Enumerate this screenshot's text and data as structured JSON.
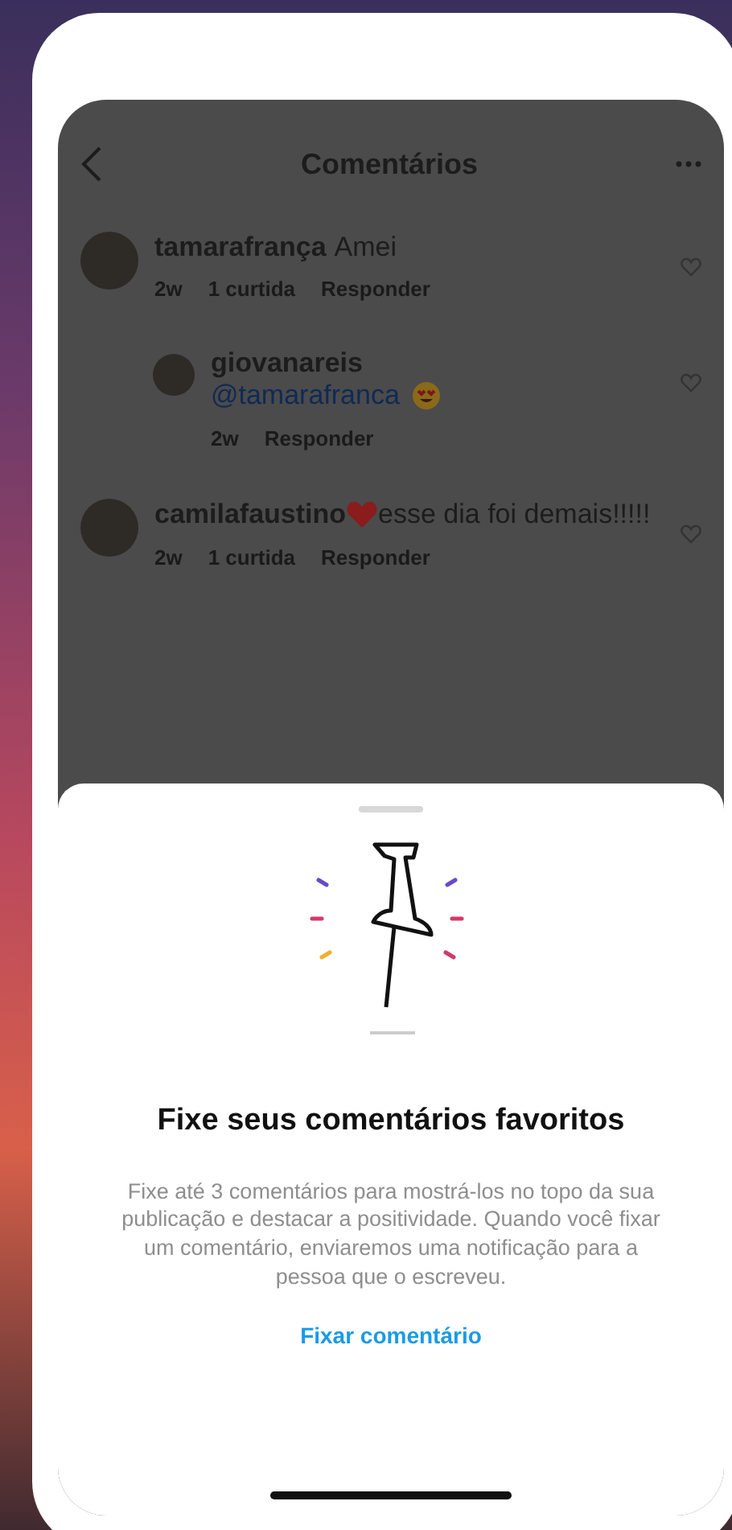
{
  "header": {
    "title": "Comentários"
  },
  "comments": [
    {
      "kind": "plain",
      "user": "tamarafrança",
      "text": "Amei",
      "time": "2w",
      "likes": "1 curtida",
      "reply": "Responder"
    },
    {
      "kind": "mention",
      "user": "giovanareis",
      "mention": "@tamarafranca",
      "time": "2w",
      "reply": "Responder"
    },
    {
      "kind": "heart",
      "user": "camilafaustino",
      "text": "esse dia foi demais!!!!!",
      "time": "2w",
      "likes": "1 curtida",
      "reply": "Responder"
    }
  ],
  "sheet": {
    "title": "Fixe seus comentários favoritos",
    "body": "Fixe até 3 comentários para mostrá-los no topo da sua publicação e destacar a positividade. Quando você fixar um comentário, enviaremos uma notificação para a pessoa que o escreveu.",
    "action": "Fixar comentário"
  }
}
